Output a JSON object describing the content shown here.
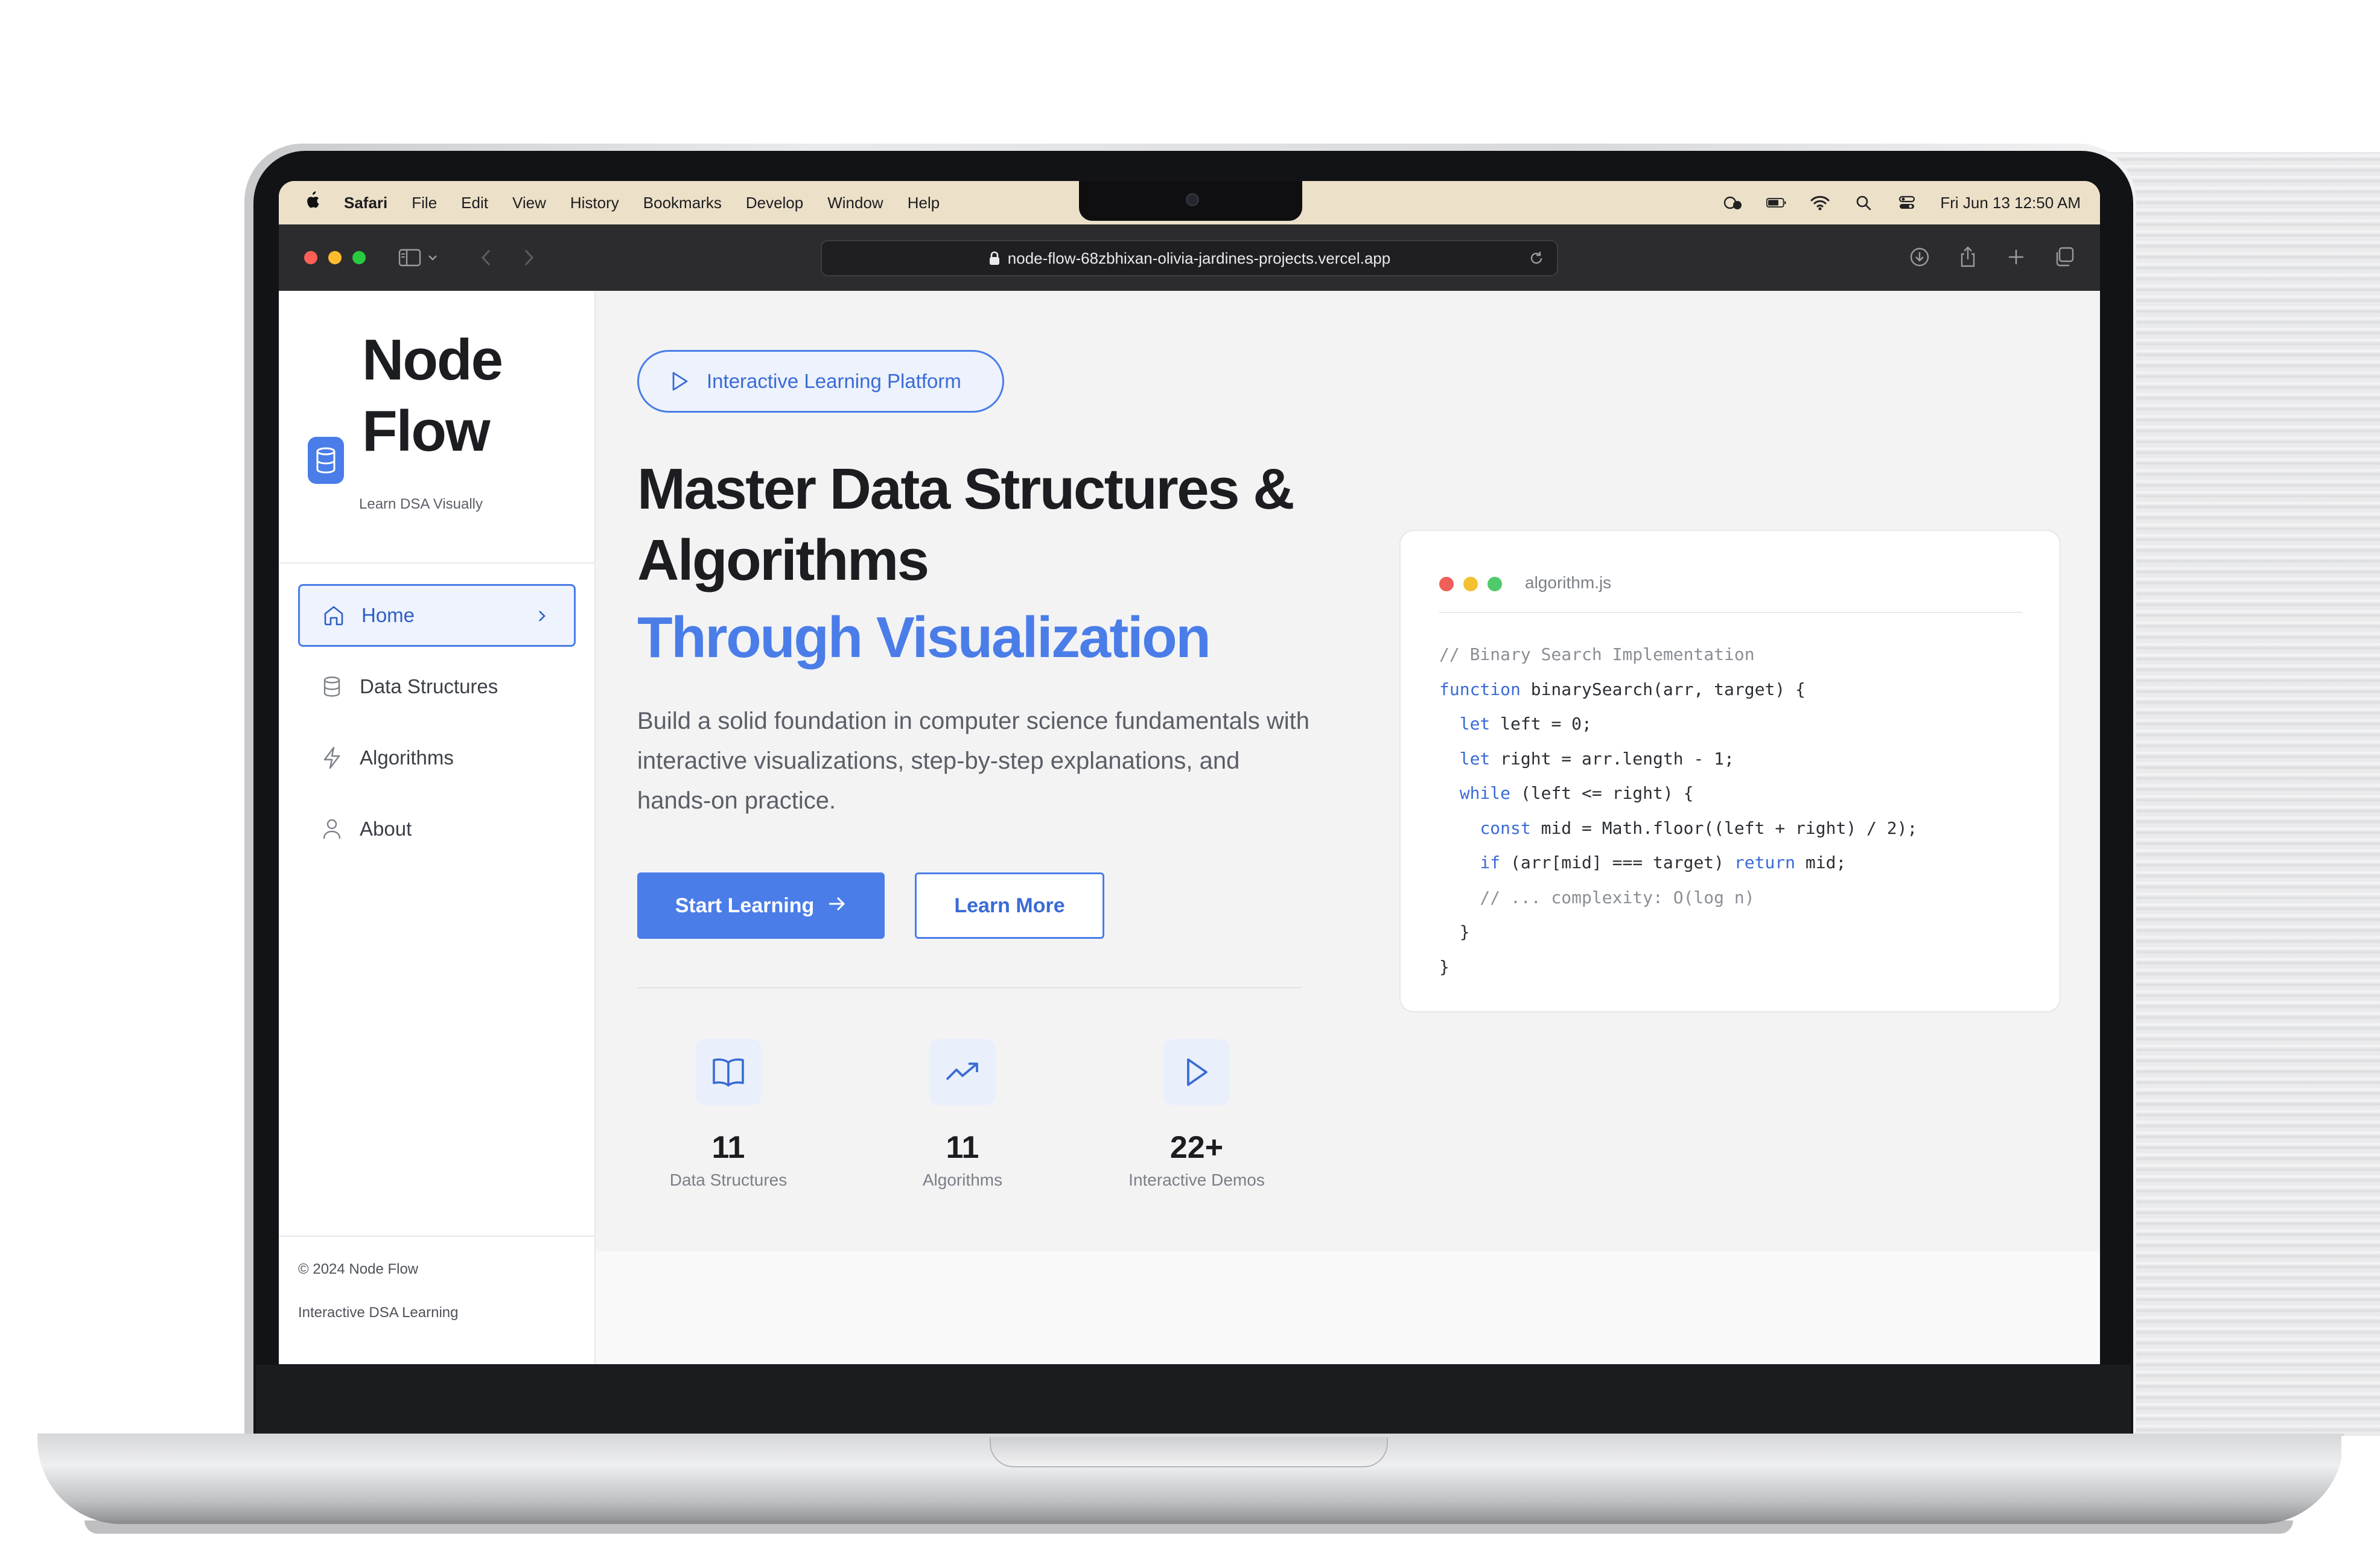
{
  "menubar": {
    "app_name": "Safari",
    "items": [
      "File",
      "Edit",
      "View",
      "History",
      "Bookmarks",
      "Develop",
      "Window",
      "Help"
    ],
    "datetime": "Fri Jun 13  12:50 AM"
  },
  "browser": {
    "url": "node-flow-68zbhixan-olivia-jardines-projects.vercel.app"
  },
  "sidebar": {
    "brand_line1": "Node",
    "brand_line2": "Flow",
    "tagline": "Learn DSA Visually",
    "nav": [
      {
        "label": "Home",
        "icon": "home-icon",
        "active": true
      },
      {
        "label": "Data Structures",
        "icon": "database-icon",
        "active": false
      },
      {
        "label": "Algorithms",
        "icon": "lightning-icon",
        "active": false
      },
      {
        "label": "About",
        "icon": "user-icon",
        "active": false
      }
    ],
    "copyright": "© 2024 Node Flow",
    "footer_tagline": "Interactive DSA Learning"
  },
  "hero": {
    "badge": "Interactive Learning Platform",
    "title": "Master Data Structures & Algorithms",
    "title_accent": "Through Visualization",
    "description": "Build a solid foundation in computer science fundamentals with interactive visualizations, step-by-step explanations, and hands-on practice.",
    "primary_cta": "Start Learning",
    "secondary_cta": "Learn More"
  },
  "stats": [
    {
      "value": "11",
      "label": "Data Structures",
      "icon": "book-icon"
    },
    {
      "value": "11",
      "label": "Algorithms",
      "icon": "trending-up-icon"
    },
    {
      "value": "22+",
      "label": "Interactive Demos",
      "icon": "play-icon"
    }
  ],
  "code_card": {
    "filename": "algorithm.js",
    "lines": [
      "// Binary Search Implementation",
      "function binarySearch(arr, target) {",
      "  let left = 0;",
      "  let right = arr.length - 1;",
      "  while (left <= right) {",
      "    const mid = Math.floor((left + right) / 2);",
      "    if (arr[mid] === target) return mid;",
      "    // ... complexity: O(log n)",
      "  }",
      "}"
    ]
  },
  "colors": {
    "accent": "#4a7de8",
    "menubar": "#ece0c9",
    "toolbar": "#2c2c2e"
  }
}
